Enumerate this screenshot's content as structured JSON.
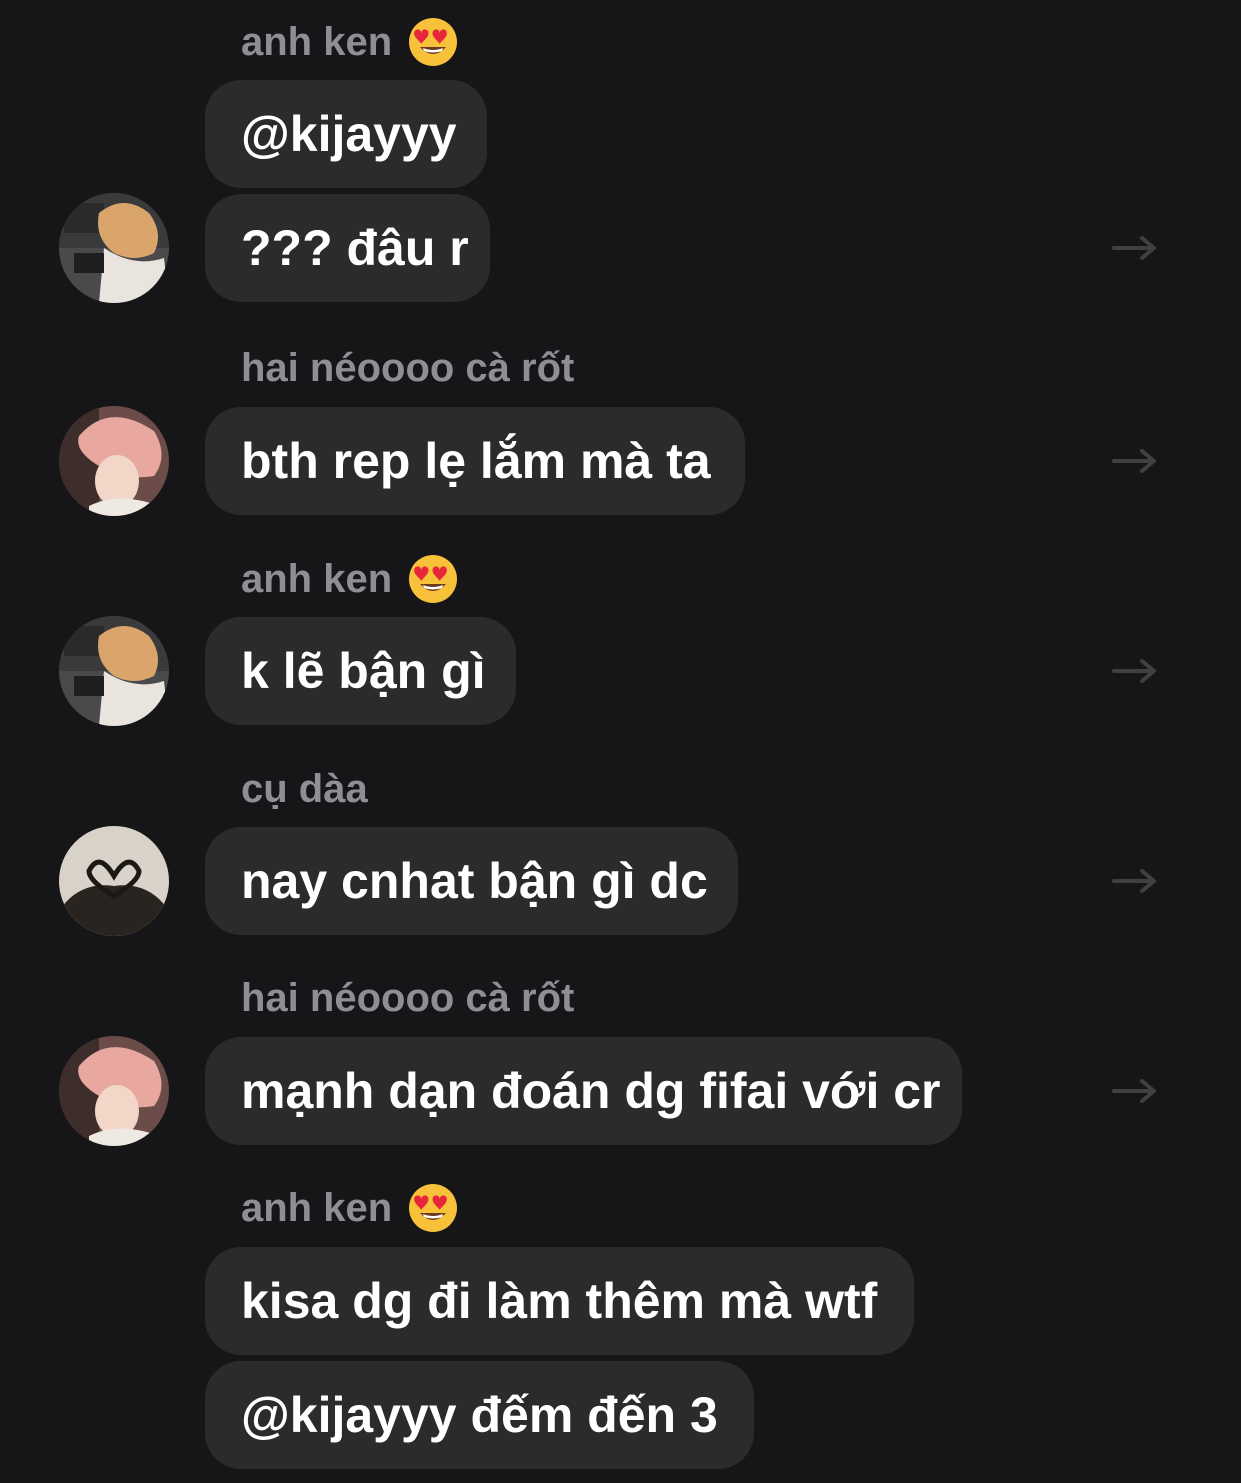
{
  "messages": [
    {
      "sender": "anh ken",
      "sender_emoji": "heart-eyes-emoji",
      "text": "@kijayyy"
    },
    {
      "text": "??? đâu r"
    },
    {
      "sender": "hai néoooo cà rốt",
      "text": "bth rep lẹ lắm mà ta"
    },
    {
      "sender": "anh ken",
      "sender_emoji": "heart-eyes-emoji",
      "text": "k lẽ bận gì"
    },
    {
      "sender": "cụ dàa",
      "text": "nay cnhat bận gì dc"
    },
    {
      "sender": "hai néoooo cà rốt",
      "text": "mạnh dạn đoán dg fifai với cr"
    },
    {
      "sender": "anh ken",
      "sender_emoji": "heart-eyes-emoji",
      "text": "kisa dg đi làm thêm mà wtf"
    },
    {
      "text": "@kijayyy đếm đến 3"
    }
  ],
  "colors": {
    "background": "#161618",
    "bubble": "#2b2b2e",
    "sender_name": "#8e8e93",
    "text": "#ffffff"
  },
  "icons": {
    "share": "share-arrow-icon",
    "emoji": "heart-eyes-emoji"
  }
}
